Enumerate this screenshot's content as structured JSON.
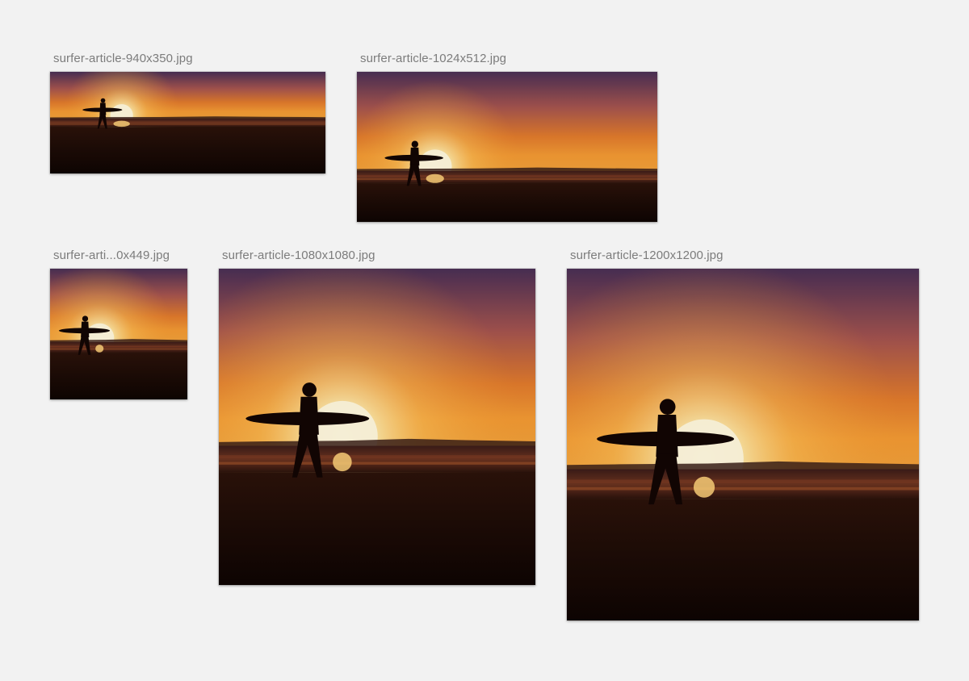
{
  "files": [
    {
      "name": "surfer-article-940x350.jpg"
    },
    {
      "name": "surfer-article-1024x512.jpg"
    },
    {
      "name": "surfer-arti...0x449.jpg"
    },
    {
      "name": "surfer-article-1080x1080.jpg"
    },
    {
      "name": "surfer-article-1200x1200.jpg"
    }
  ],
  "colors": {
    "background": "#f2f2f2",
    "label": "#7c7c7c",
    "sky_top": "#4a2f55",
    "sky_mid": "#e07a2c",
    "sun": "#fff3c4",
    "sand": "#160805"
  }
}
